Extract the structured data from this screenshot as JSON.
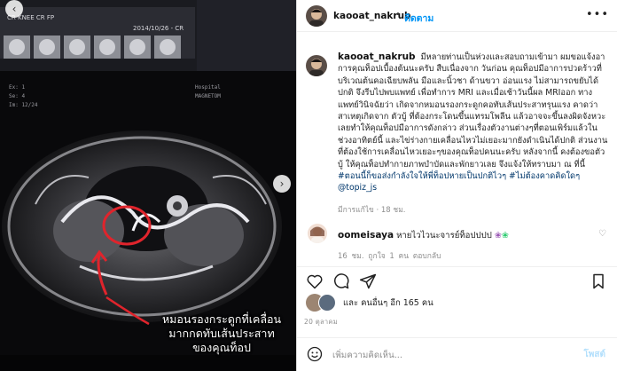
{
  "post": {
    "username": "kaooat_nakrub",
    "follow_label": "ติดตาม",
    "separator": "•",
    "caption": "มีหลายท่านเป็นห่วงและสอบถามเข้ามา ผมขอแจ้งอาการคุณท็อปเบื้องต้นนะครับ สืบเนื่องจาก วันก่อน คุณท็อปมีอาการปวดร้าวที่บริเวณต้นคอเฉียบพลัน มือและนิ้วชา ด้านขวา อ่อนแรง ไม่สามารถขยับได้ ปกติ จึงรีบไปพบแพทย์ เพื่อทำการ MRI และเมื่อเช้าวันนี้ผล MRIออก ทางแพทย์วินิจฉัยว่า เกิดจากหมอนรองกระดูกคอทับเส้นประสาทรุนแรง คาดว่าสาเหตุเกิดจาก ตัวบู้ ที่ต้องกระโดนขึ้นแทรมโพลีน แล้วอาจจะขึ้นลงผิดจังหวะ เลยทำให้คุณท็อปมีอาการดังกล่าว ส่วนเรื่องตัวงานต่างๆที่ตอนเพิร์มแล้วในช่วงอาทิตย์นี้ และไข่ร่างกายเคลื่อนไหวไม่เยอะมากยังดำเนินได้ปกติ ส่วนงานที่ต้องใช้การเคลื่อนไหวเยอะๆของคุณท็อปคนนะครับ หลังจากนี้ คงต้องขอตัวบู้ ให้คุณท็อปทำกายภาพบำบัดและพักยาวเลย จึงแจ้งให้ทราบมา ณ ที่นี้",
    "tags": "#ตอนนี้ก็ขอส่งกำลังใจให้พี่ท็อปหายเป็นปกติไวๆ #ไม่ต้องคาดคิดใดๆ",
    "mention": "@topiz_js",
    "edited": "มีการแก้ไข · 18 ชม.",
    "image_caption_line1": "หมอนรองกระดูกที่เคลื่อน",
    "image_caption_line2": "มากกดทับเส้นประสาท",
    "image_caption_line3": "ของคุณท็อป",
    "mri_label_left": "CR  KNEE  CR  FP",
    "mri_label_right": "2014/10/26 - CR"
  },
  "comment": {
    "username": "oomeisaya",
    "text": "หายไวไวนะจารย์ท็อปปปป",
    "time": "16 ชม.",
    "likes": "ถูกใจ 1 คน",
    "reply": "ตอบกลับ"
  },
  "likes_text": "และ คนอื่นๆ อีก 165 คน",
  "date": "20 ตุลาคม",
  "composer": {
    "placeholder": "เพิ่มความคิดเห็น...",
    "post_label": "โพสต์"
  },
  "colors": {
    "follow": "#0095f6",
    "post_disabled": "#b2dffc",
    "meta": "#8e8e8e"
  }
}
